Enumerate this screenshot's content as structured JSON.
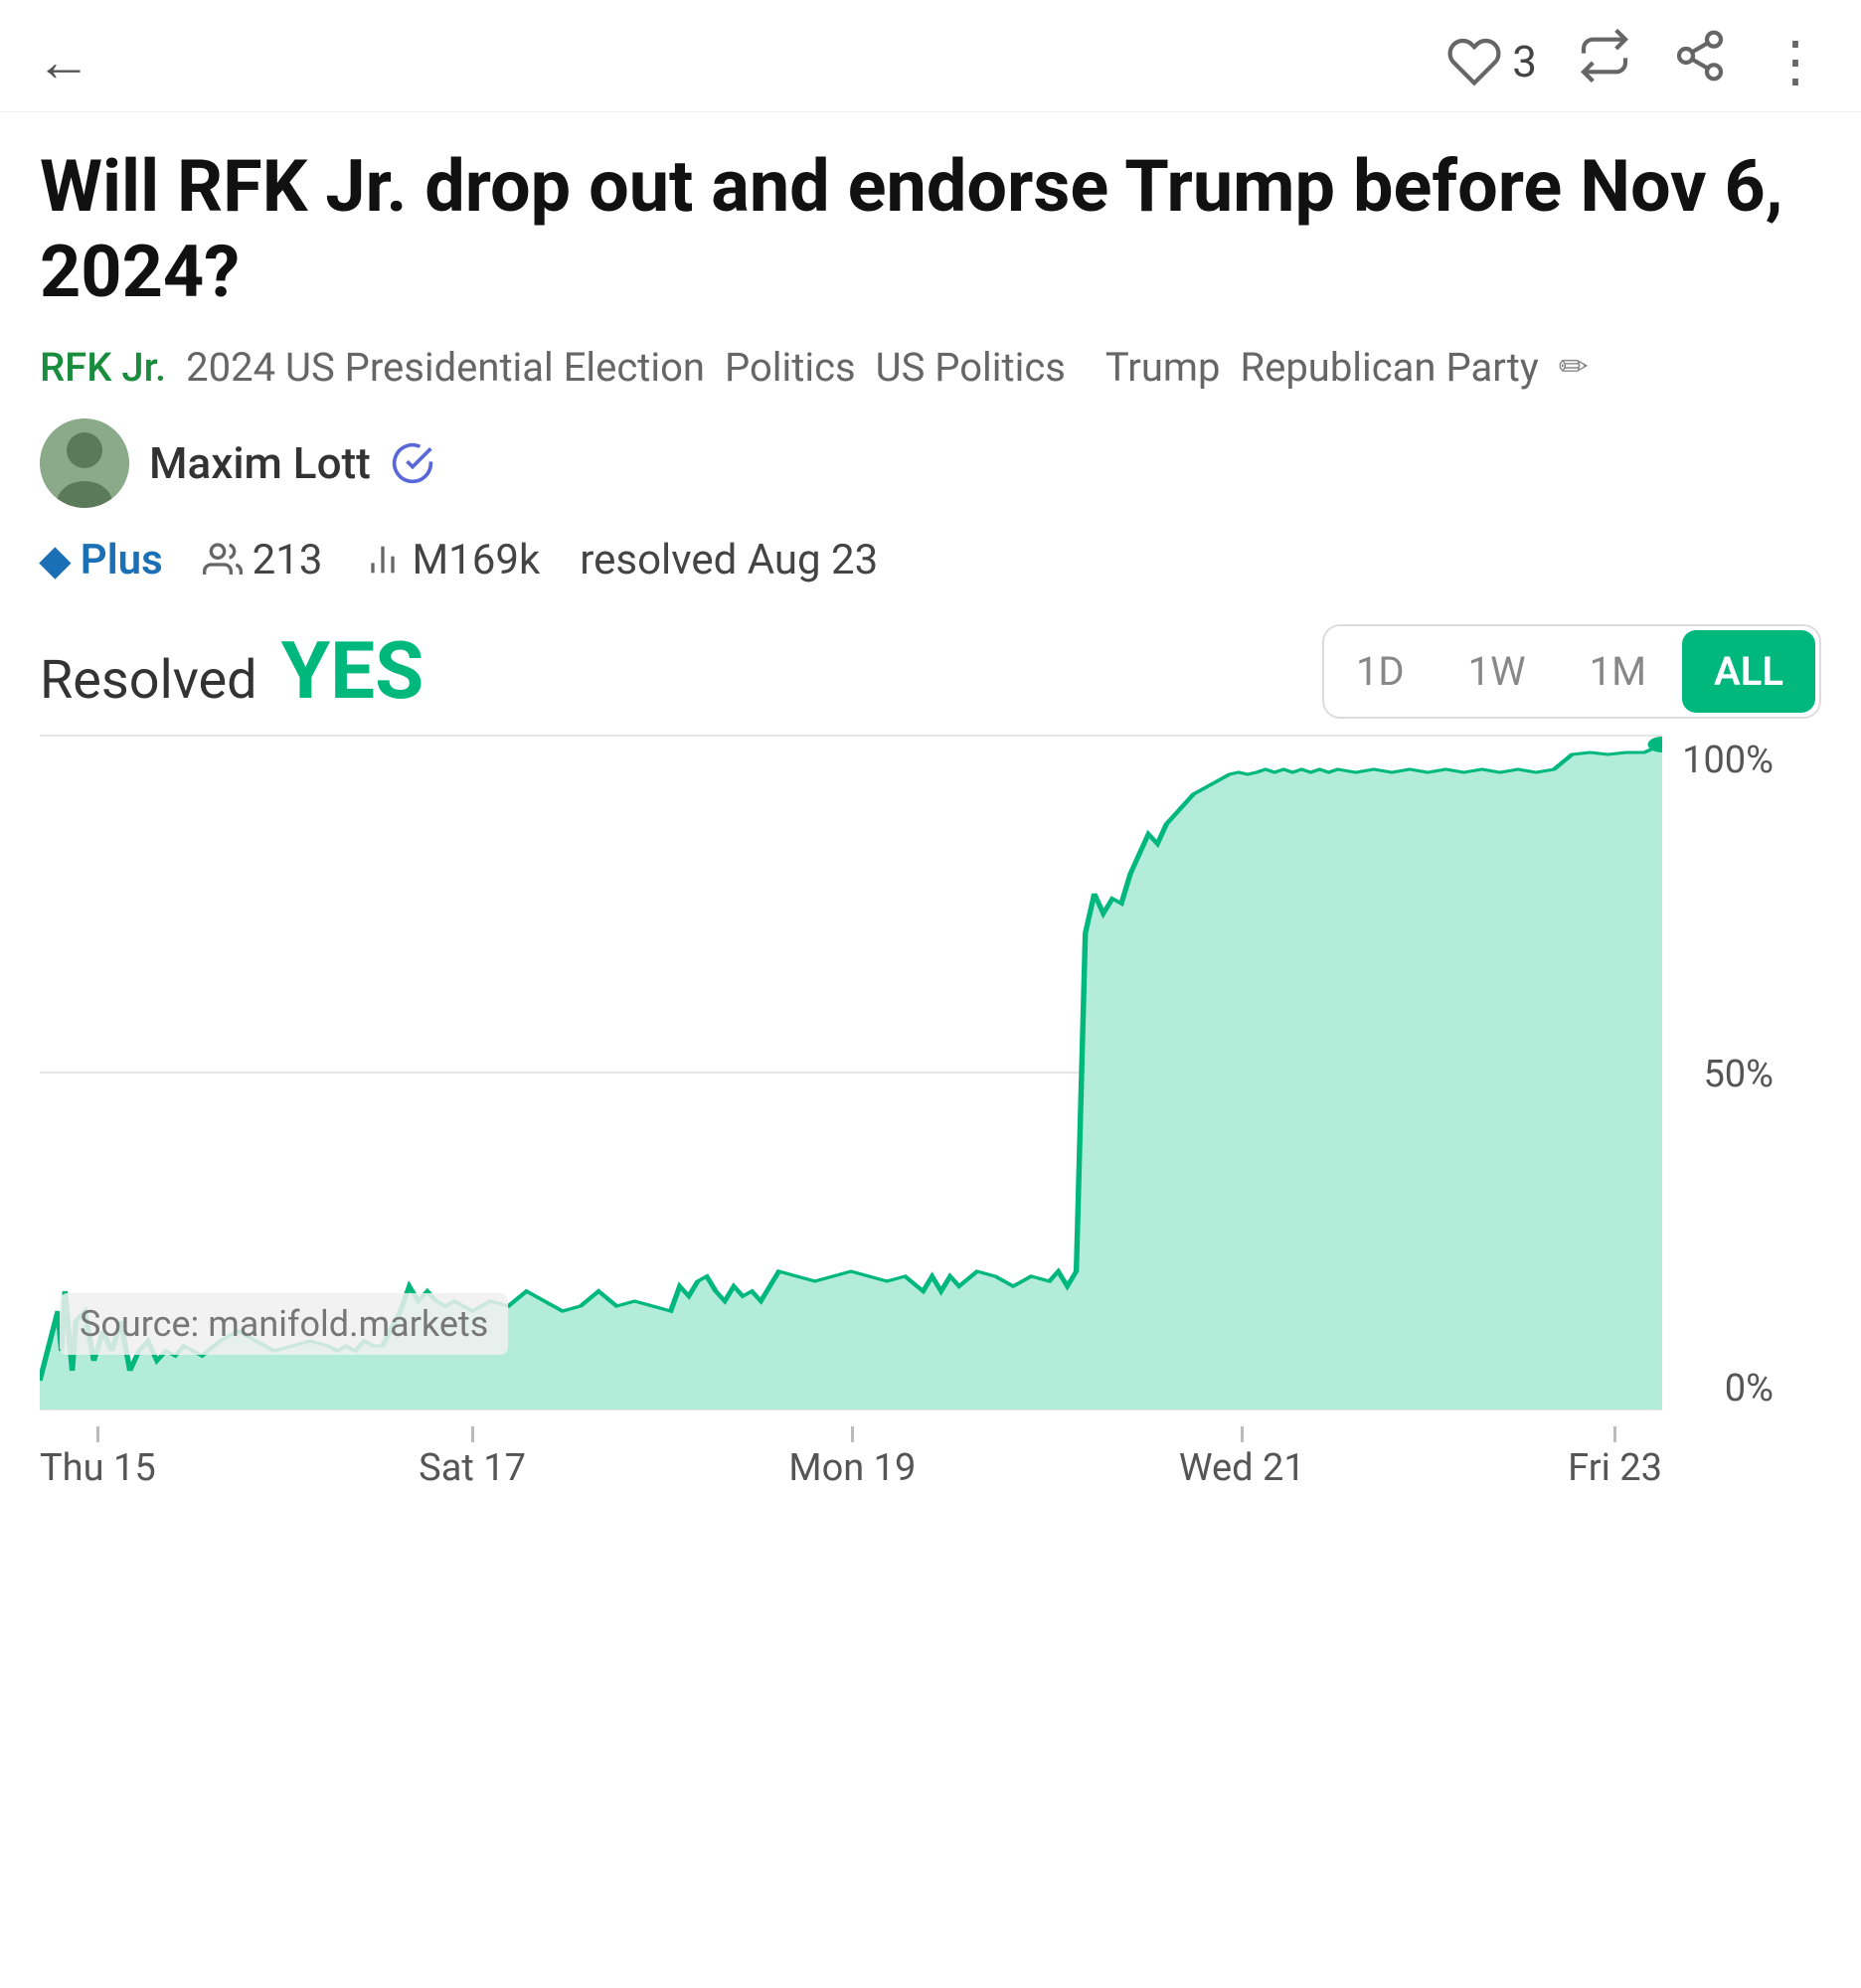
{
  "header": {
    "back_label": "←",
    "like_count": "3",
    "retweet_icon": "⟲",
    "share_icon": "⋯",
    "more_icon": "⋮"
  },
  "question": {
    "title": "Will RFK Jr. drop out and endorse Trump before Nov 6, 2024?",
    "tags": [
      {
        "id": "rfk",
        "label": "RFK Jr.",
        "primary": true
      },
      {
        "id": "election",
        "label": "2024 US Presidential Election",
        "primary": false
      },
      {
        "id": "politics",
        "label": "Politics",
        "primary": false
      },
      {
        "id": "uspolitics",
        "label": "US Politics",
        "primary": false
      },
      {
        "id": "trump",
        "label": "Trump",
        "primary": false
      },
      {
        "id": "republican",
        "label": "Republican Party",
        "primary": false
      }
    ]
  },
  "author": {
    "name": "Maxim Lott",
    "verified": true
  },
  "stats": {
    "plus_label": "Plus",
    "participants": "213",
    "volume": "M169k",
    "resolved_date": "resolved Aug 23"
  },
  "resolution": {
    "label": "Resolved",
    "value": "YES"
  },
  "time_selector": {
    "options": [
      "1D",
      "1W",
      "1M",
      "ALL"
    ],
    "active": "ALL"
  },
  "chart": {
    "y_labels": [
      "100%",
      "50%",
      "0%"
    ],
    "x_labels": [
      {
        "tick": "Thu 15"
      },
      {
        "tick": "Sat 17"
      },
      {
        "tick": "Mon 19"
      },
      {
        "tick": "Wed 21"
      },
      {
        "tick": "Fri 23"
      }
    ],
    "source": "Source: manifold.markets",
    "color": "#00b87c",
    "fill_color": "#b3edd9"
  }
}
